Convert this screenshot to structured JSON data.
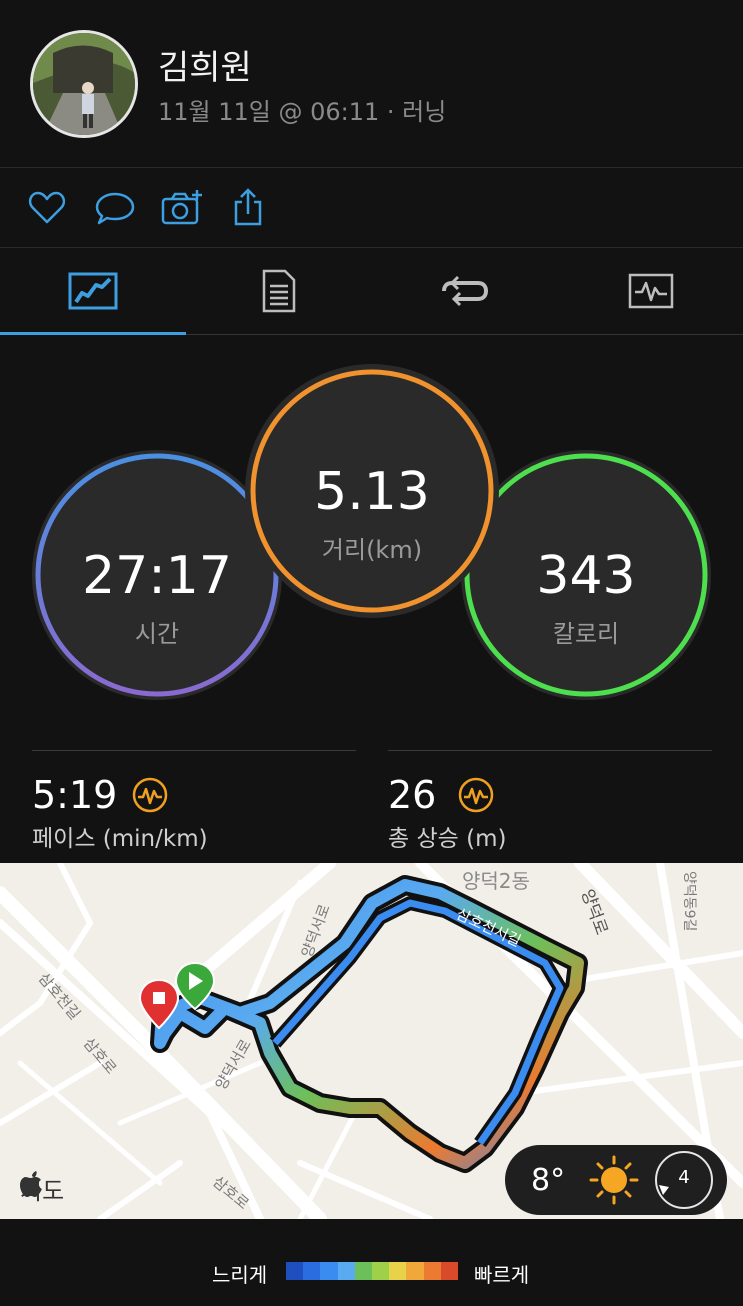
{
  "header": {
    "name": "김희원",
    "subtitle": "11월 11일 @ 06:11 · 러닝"
  },
  "actions": {
    "icons": [
      "heart-icon",
      "comment-icon",
      "camera-icon",
      "share-icon"
    ],
    "accent": "#3d9ee0"
  },
  "tabs": {
    "icons": [
      "overview-icon",
      "details-icon",
      "laps-icon",
      "charts-icon"
    ],
    "active": 0
  },
  "circles": {
    "time": {
      "value": "27:17",
      "label": "시간",
      "color_top": "#4a90e2",
      "color_bottom": "#8a6ad0"
    },
    "distance": {
      "value": "5.13",
      "label": "거리(km)",
      "color": "#f0922e"
    },
    "calories": {
      "value": "343",
      "label": "칼로리",
      "color": "#4ddf4d"
    }
  },
  "stats": {
    "pace": {
      "value": "5:19",
      "label": "페이스 (min/km)"
    },
    "elevation": {
      "value": "26",
      "label": "총 상승 (m)"
    },
    "icon_color": "#f0a020"
  },
  "map": {
    "labels": {
      "yangdeok2dong": "양덕2동",
      "yangdeokro": "양덕로",
      "yangdeokseoro_top": "양덕서로",
      "yangdeokseoro_bottom": "양덕서로",
      "samhocheonseogil_top": "삼호천서길",
      "samhocheongil": "삼호천길",
      "samhoro_left": "삼호로",
      "samhoro_bottom": "삼호로",
      "yangdeok9gil": "양덕동9길"
    },
    "attribution": "지도",
    "weather": {
      "temperature": "8°",
      "wind": "4"
    }
  },
  "legend": {
    "slow": "느리게",
    "fast": "빠르게",
    "colors": [
      "#1f4fbf",
      "#2a6de0",
      "#3b8cf0",
      "#5aaaf0",
      "#6cc05a",
      "#9ed04a",
      "#e8d24a",
      "#f0a83a",
      "#ec7a30",
      "#d84a2a"
    ]
  }
}
